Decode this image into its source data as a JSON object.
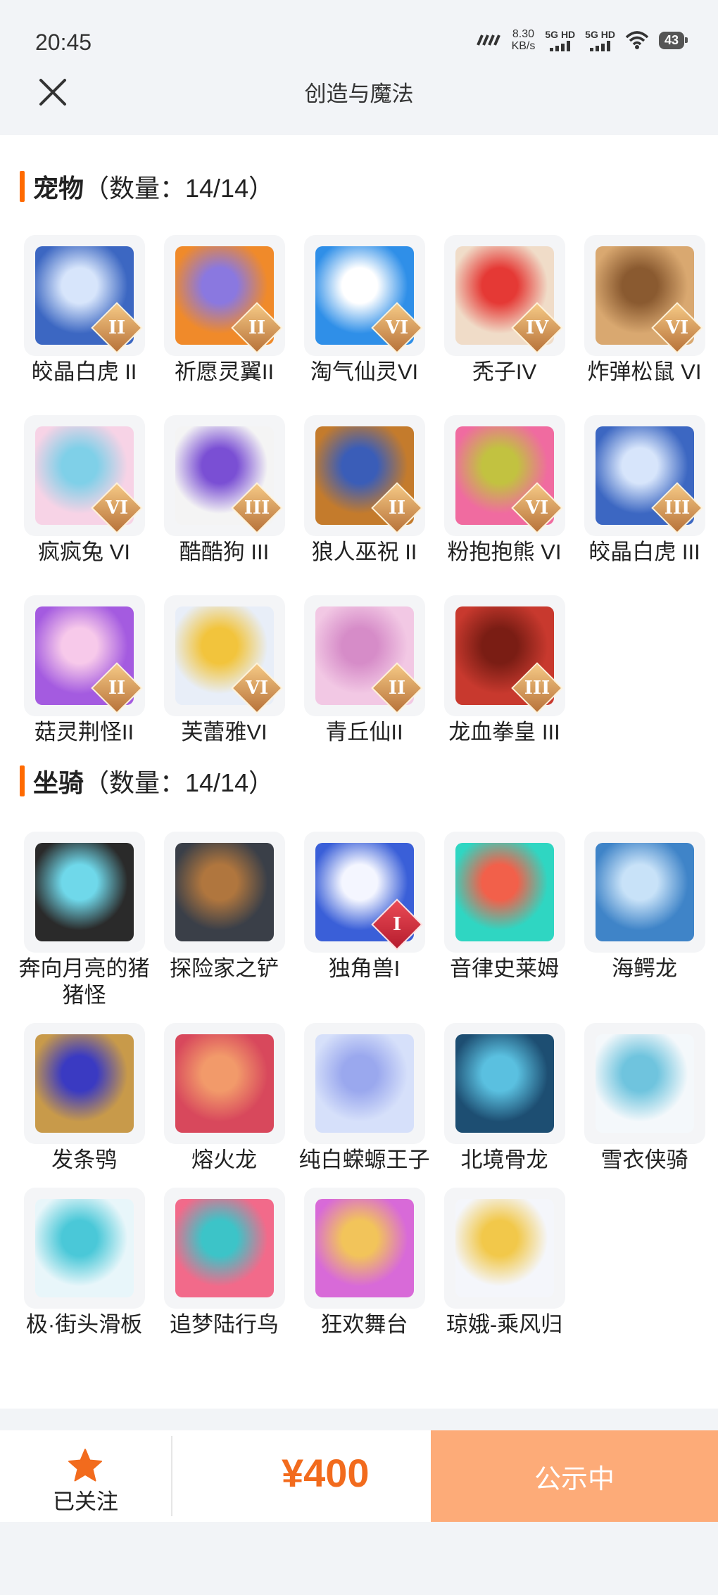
{
  "status_bar": {
    "time": "20:45",
    "speed_value": "8.30",
    "speed_unit": "KB/s",
    "network1": "5G HD",
    "network2": "5G HD",
    "battery": "43"
  },
  "nav": {
    "title": "创造与魔法",
    "close_icon": "close-icon"
  },
  "pets_section": {
    "name": "宠物",
    "count": "（数量：14/14）",
    "items": [
      {
        "label": "皎晶白虎 II",
        "badge": "II",
        "colors": [
          "#3c67c2",
          "#d7e5fb"
        ]
      },
      {
        "label": "祈愿灵翼II",
        "badge": "II",
        "colors": [
          "#f08a2a",
          "#8a78e0"
        ]
      },
      {
        "label": "淘气仙灵VI",
        "badge": "VI",
        "colors": [
          "#2f8fe8",
          "#ffffff"
        ]
      },
      {
        "label": "秃子IV",
        "badge": "IV",
        "colors": [
          "#f0dcc8",
          "#e53935"
        ]
      },
      {
        "label": "炸弹松鼠 VI",
        "badge": "VI",
        "colors": [
          "#d9a870",
          "#8a5a30"
        ]
      },
      {
        "label": "疯疯兔 VI",
        "badge": "VI",
        "colors": [
          "#f7d3e6",
          "#7fd0e8"
        ]
      },
      {
        "label": "酷酷狗 III",
        "badge": "III",
        "colors": [
          "#f4f4f4",
          "#7a4fd4"
        ]
      },
      {
        "label": "狼人巫祝 II",
        "badge": "II",
        "colors": [
          "#c47b2c",
          "#3a5db8"
        ]
      },
      {
        "label": "粉抱抱熊 VI",
        "badge": "VI",
        "colors": [
          "#f06ba0",
          "#c2c240"
        ]
      },
      {
        "label": "皎晶白虎 III",
        "badge": "III",
        "colors": [
          "#3c67c2",
          "#d7e5fb"
        ]
      },
      {
        "label": "菇灵荆怪II",
        "badge": "II",
        "colors": [
          "#a45be0",
          "#f7c9ea"
        ]
      },
      {
        "label": "芙蕾雅VI",
        "badge": "VI",
        "colors": [
          "#e8eef8",
          "#f2c43c"
        ]
      },
      {
        "label": "青丘仙II",
        "badge": "II",
        "colors": [
          "#f2c8e4",
          "#d68cc8"
        ]
      },
      {
        "label": "龙血拳皇 III",
        "badge": "III",
        "colors": [
          "#c8392e",
          "#7a1d14"
        ]
      }
    ]
  },
  "mounts_section": {
    "name": "坐骑",
    "count": "（数量：14/14）",
    "items": [
      {
        "label": "奔向月亮的猪猪怪",
        "badge": "",
        "colors": [
          "#2a2a2a",
          "#6fd8ea"
        ]
      },
      {
        "label": "探险家之铲",
        "badge": "",
        "colors": [
          "#3a3f48",
          "#b0763e"
        ]
      },
      {
        "label": "独角兽I",
        "badge": "I",
        "colors": [
          "#3a5fd8",
          "#f4f6ff"
        ]
      },
      {
        "label": "音律史莱姆",
        "badge": "",
        "colors": [
          "#2fd6c2",
          "#f2604a"
        ]
      },
      {
        "label": "海鳄龙",
        "badge": "",
        "colors": [
          "#3f84c8",
          "#c8e2f8"
        ]
      },
      {
        "label": "发条鸮",
        "badge": "",
        "colors": [
          "#c89a4a",
          "#3a3ac2"
        ]
      },
      {
        "label": "熔火龙",
        "badge": "",
        "colors": [
          "#d8485c",
          "#f29a6a"
        ]
      },
      {
        "label": "纯白蝾螈王子",
        "badge": "",
        "colors": [
          "#d6e0fa",
          "#9aa8ee"
        ]
      },
      {
        "label": "北境骨龙",
        "badge": "",
        "colors": [
          "#1d4e72",
          "#5ac0e0"
        ]
      },
      {
        "label": "雪衣侠骑",
        "badge": "",
        "colors": [
          "#f4f8fb",
          "#6fc4de"
        ]
      },
      {
        "label": "极·街头滑板",
        "badge": "",
        "colors": [
          "#e8f6fa",
          "#4ac8d8"
        ]
      },
      {
        "label": "追梦陆行鸟",
        "badge": "",
        "colors": [
          "#f26a8a",
          "#3cc4c8"
        ]
      },
      {
        "label": "狂欢舞台",
        "badge": "",
        "colors": [
          "#d86ad8",
          "#f2c45a"
        ]
      },
      {
        "label": "琼娥-乘风归",
        "badge": "",
        "colors": [
          "#f4f6fb",
          "#f2c84a"
        ]
      }
    ]
  },
  "footer": {
    "follow_label": "已关注",
    "star_icon": "star-icon",
    "price": "¥400",
    "status_label": "公示中",
    "accent": "#f26b1d"
  }
}
